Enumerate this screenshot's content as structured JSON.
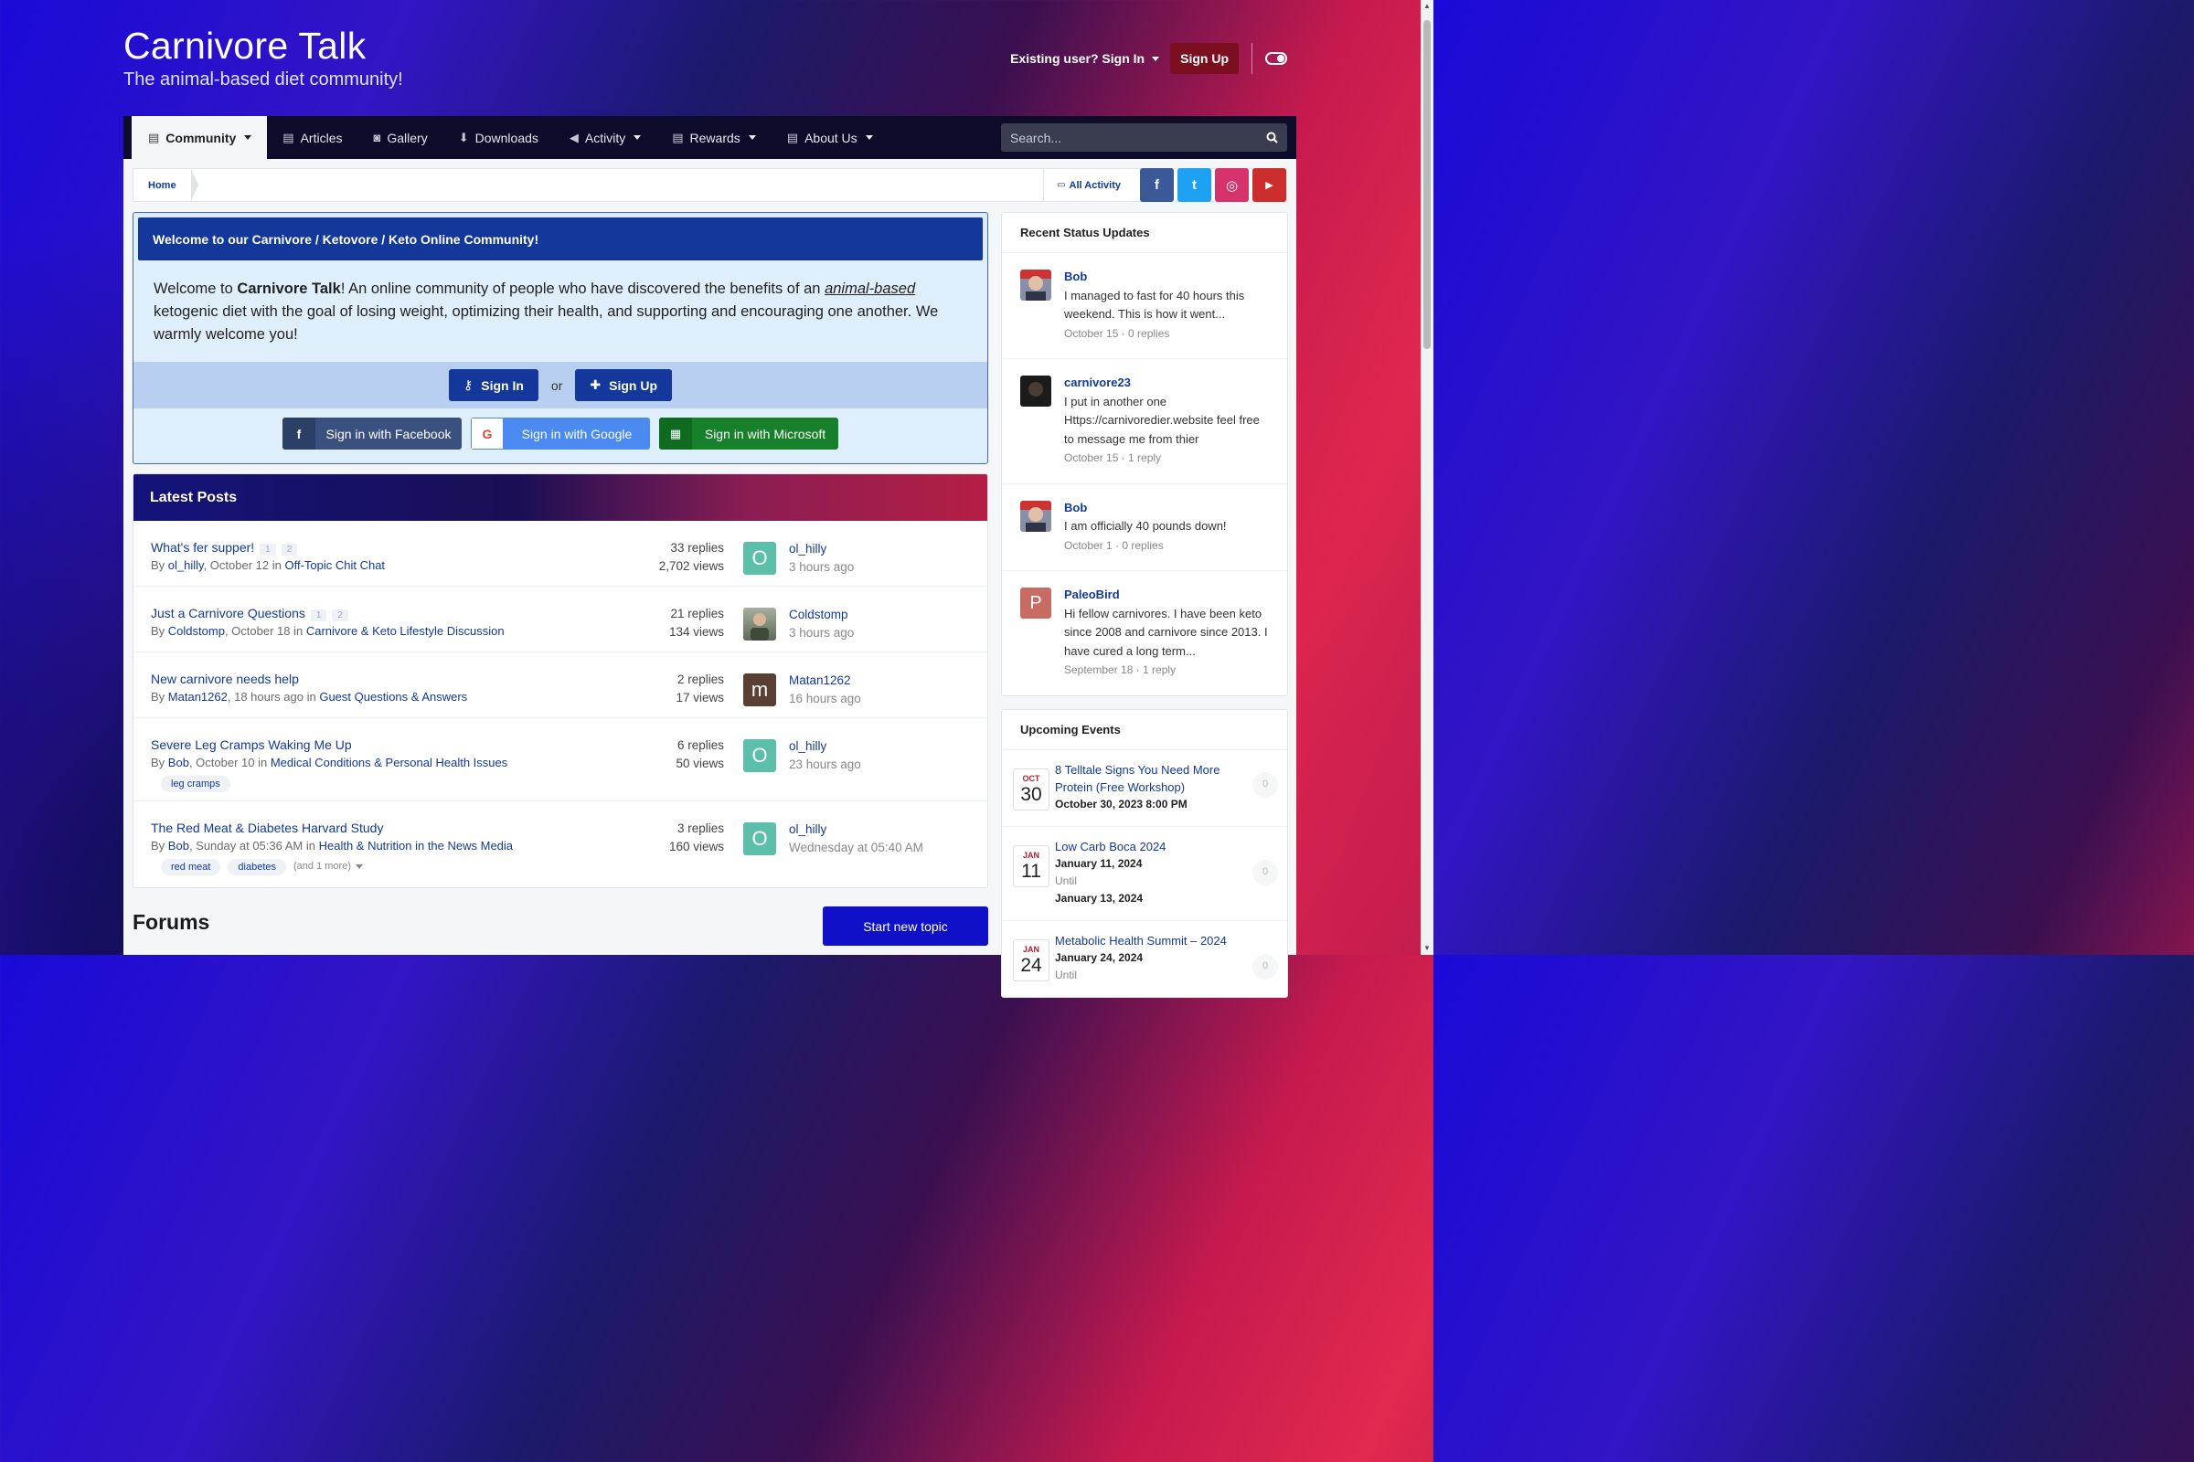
{
  "brand": {
    "title": "Carnivore Talk",
    "tagline": "The animal-based diet community!"
  },
  "userbar": {
    "signin": "Existing user? Sign In",
    "signup": "Sign Up"
  },
  "nav": {
    "items": [
      "Community",
      "Articles",
      "Gallery",
      "Downloads",
      "Activity",
      "Rewards",
      "About Us"
    ],
    "search_placeholder": "Search..."
  },
  "breadcrumb": {
    "home": "Home",
    "all_activity": "All Activity"
  },
  "social": {
    "facebook": "f",
    "twitter": "t",
    "instagram": "◎",
    "youtube": "▶"
  },
  "welcome": {
    "heading": "Welcome to our Carnivore / Ketovore / Keto Online Community!",
    "text_before": "Welcome to ",
    "site_name": "Carnivore Talk",
    "text_mid": "! An online community of people who have discovered the benefits of an ",
    "link": "animal-based",
    "text_after": " ketogenic diet with the goal of losing weight, optimizing their health, and supporting and encouraging one another. We warmly welcome you!",
    "signin_btn": "Sign In",
    "or": "or",
    "signup_btn": "Sign Up",
    "facebook_btn": "Sign in with Facebook",
    "google_btn": "Sign in with Google",
    "microsoft_btn": "Sign in with Microsoft"
  },
  "latest": {
    "heading": "Latest Posts",
    "posts": [
      {
        "title": "What's fer supper!",
        "pages": [
          "1",
          "2"
        ],
        "by": "By ",
        "author": "ol_hilly",
        "when": ", October 12 in ",
        "forum": "Off-Topic Chit Chat",
        "replies": "33 replies",
        "views": "2,702 views",
        "last_user": "ol_hilly",
        "last_time": "3 hours ago",
        "avatar_letter": "O",
        "avatar_color": "#5cbfa9"
      },
      {
        "title": "Just a Carnivore Questions",
        "pages": [
          "1",
          "2"
        ],
        "by": "By ",
        "author": "Coldstomp",
        "when": ", October 18 in ",
        "forum": "Carnivore & Keto Lifestyle Discussion",
        "replies": "21 replies",
        "views": "134 views",
        "last_user": "Coldstomp",
        "last_time": "3 hours ago",
        "avatar_letter": "",
        "avatar_color": "#6c7560"
      },
      {
        "title": "New carnivore needs help",
        "pages": [],
        "by": "By ",
        "author": "Matan1262",
        "when": ", 18 hours ago in ",
        "forum": "Guest Questions & Answers",
        "replies": "2 replies",
        "views": "17 views",
        "last_user": "Matan1262",
        "last_time": "16 hours ago",
        "avatar_letter": "m",
        "avatar_color": "#5a4033"
      },
      {
        "title": "Severe Leg Cramps Waking Me Up",
        "pages": [],
        "by": "By ",
        "author": "Bob",
        "when": ", October 10 in ",
        "forum": "Medical Conditions & Personal Health Issues",
        "replies": "6 replies",
        "views": "50 views",
        "last_user": "ol_hilly",
        "last_time": "23 hours ago",
        "avatar_letter": "O",
        "avatar_color": "#5cbfa9",
        "tags": [
          "leg cramps"
        ]
      },
      {
        "title": "The Red Meat & Diabetes Harvard Study",
        "pages": [],
        "by": "By ",
        "author": "Bob",
        "when": ", Sunday at 05:36 AM in ",
        "forum": "Health & Nutrition in the News Media",
        "replies": "3 replies",
        "views": "160 views",
        "last_user": "ol_hilly",
        "last_time": "Wednesday at 05:40 AM",
        "avatar_letter": "O",
        "avatar_color": "#5cbfa9",
        "tags": [
          "red meat",
          "diabetes"
        ],
        "more": "(and 1 more)"
      }
    ]
  },
  "forums": {
    "title": "Forums",
    "new_topic": "Start new topic"
  },
  "status_updates": {
    "heading": "Recent Status Updates",
    "items": [
      {
        "name": "Bob",
        "text": "I managed to fast for 40 hours this weekend. This is how it went...",
        "meta": "October 15 · 0 replies"
      },
      {
        "name": "carnivore23",
        "text": "I put in another one Https://carnivoredier.website feel free to message me from thier",
        "meta": "October 15 · 1 reply"
      },
      {
        "name": "Bob",
        "text": "I am officially 40 pounds down!",
        "meta": "October 1 · 0 replies"
      },
      {
        "name": "PaleoBird",
        "text": "Hi fellow carnivores.  I have been keto since 2008 and carnivore since 2013.  I have cured a long term...",
        "meta": "September 18 · 1 reply",
        "letter": "P"
      }
    ]
  },
  "events": {
    "heading": "Upcoming Events",
    "items": [
      {
        "mon": "OCT",
        "day": "30",
        "name": "8 Telltale Signs You Need More Protein (Free Workshop)",
        "when": "October 30, 2023 8:00 PM",
        "until": "",
        "end": "",
        "count": "0"
      },
      {
        "mon": "JAN",
        "day": "11",
        "name": "Low Carb Boca 2024",
        "when": "January 11, 2024",
        "until": "Until",
        "end": "January 13, 2024",
        "count": "0"
      },
      {
        "mon": "JAN",
        "day": "24",
        "name": "Metabolic Health Summit – 2024",
        "when": "January 24, 2024",
        "until": "Until",
        "end": "",
        "count": "0"
      }
    ]
  }
}
